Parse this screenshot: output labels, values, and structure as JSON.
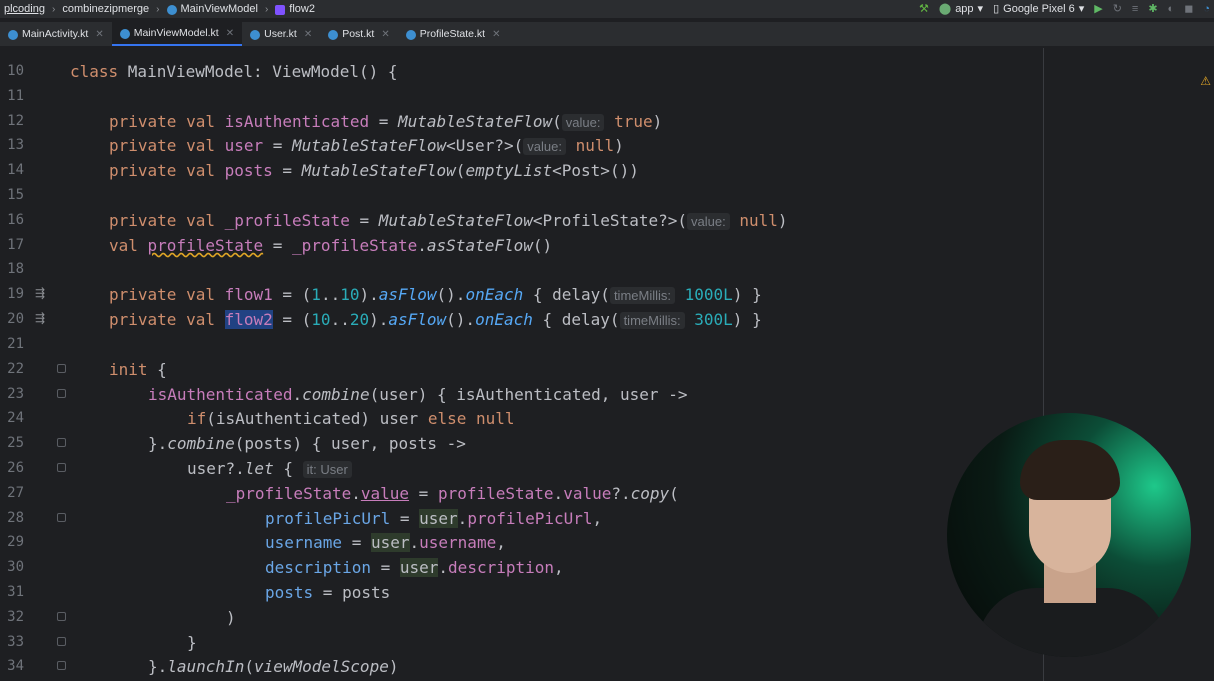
{
  "breadcrumbs": [
    "plcoding",
    "combinezipmerge",
    "MainViewModel",
    "flow2"
  ],
  "run_config": {
    "module": "app",
    "device": "Google Pixel 6"
  },
  "tabs": [
    {
      "label": "MainActivity.kt",
      "active": false
    },
    {
      "label": "MainViewModel.kt",
      "active": true
    },
    {
      "label": "User.kt",
      "active": false
    },
    {
      "label": "Post.kt",
      "active": false
    },
    {
      "label": "ProfileState.kt",
      "active": false
    }
  ],
  "line_numbers": [
    "10",
    "11",
    "12",
    "13",
    "14",
    "15",
    "16",
    "17",
    "18",
    "19",
    "20",
    "21",
    "22",
    "23",
    "24",
    "25",
    "26",
    "27",
    "28",
    "29",
    "30",
    "31",
    "32",
    "33",
    "34"
  ],
  "code": {
    "l10_kw": "class ",
    "l10_name": "MainViewModel",
    "l10_sep": ": ",
    "l10_super": "ViewModel",
    "l10_end": "() {",
    "l12_kw": "private val ",
    "l12_name": "isAuthenticated",
    "l12_eq": " = ",
    "l12_call": "MutableStateFlow",
    "l12_open": "(",
    "l12_hint": "value:",
    "l12_val": "true",
    "l12_close": ")",
    "l13_kw": "private val ",
    "l13_name": "user",
    "l13_eq": " = ",
    "l13_call": "MutableStateFlow",
    "l13_gen": "<User?>",
    "l13_open": "(",
    "l13_hint": "value:",
    "l13_val": "null",
    "l13_close": ")",
    "l14_kw": "private val ",
    "l14_name": "posts",
    "l14_eq": " = ",
    "l14_call": "MutableStateFlow",
    "l14_open": "(",
    "l14_call2": "emptyList",
    "l14_rest": "<Post>())",
    "l16_kw": "private val ",
    "l16_name": "_profileState",
    "l16_eq": " = ",
    "l16_call": "MutableStateFlow",
    "l16_gen": "<ProfileState?>",
    "l16_open": "(",
    "l16_hint": "value:",
    "l16_val": "null",
    "l16_close": ")",
    "l17_kw": "val ",
    "l17_name": "profileState",
    "l17_eq": " = ",
    "l17_ref": "_profileState",
    "l17_dot": ".",
    "l17_call": "asStateFlow",
    "l17_end": "()",
    "l19_kw": "private val ",
    "l19_name": "flow1",
    "l19_eq": " = (",
    "l19_a": "1",
    "l19_range": "..",
    "l19_b": "10",
    "l19_c": ").",
    "l19_f1": "asFlow",
    "l19_d": "().",
    "l19_f2": "onEach",
    "l19_e": " { delay(",
    "l19_hint": "timeMillis:",
    "l19_val": "1000L",
    "l19_end": ") }",
    "l20_kw": "private val ",
    "l20_name": "flow2",
    "l20_eq": " = (",
    "l20_a": "10",
    "l20_range": "..",
    "l20_b": "20",
    "l20_c": ").",
    "l20_f1": "asFlow",
    "l20_d": "().",
    "l20_f2": "onEach",
    "l20_e": " { delay(",
    "l20_hint": "timeMillis:",
    "l20_val": "300L",
    "l20_end": ") }",
    "l22_kw": "init",
    "l22_end": " {",
    "l23_ref": "isAuthenticated",
    "l23_dot": ".",
    "l23_call": "combine",
    "l23_rest": "(user) { isAuthenticated, user ->",
    "l24_kw": "if",
    "l24_mid": "(isAuthenticated) user ",
    "l24_else": "else null",
    "l25_a": "}.",
    "l25_call": "combine",
    "l25_rest": "(posts) { user, posts ->",
    "l26_a": "user?.",
    "l26_call": "let",
    "l26_b": " { ",
    "l26_hint": "it: User",
    "l27_ref": "_profileState",
    "l27_dot": ".",
    "l27_prop": "value",
    "l27_eq": " = ",
    "l27_ref2": "profileState",
    "l27_b": ".",
    "l27_prop2": "value",
    "l27_c": "?.",
    "l27_call": "copy",
    "l27_d": "(",
    "l28_prm": "profilePicUrl",
    "l28_eq": " = ",
    "l28_u": "user",
    "l28_dot": ".",
    "l28_prop": "profilePicUrl",
    "l28_end": ",",
    "l29_prm": "username",
    "l29_eq": " = ",
    "l29_u": "user",
    "l29_dot": ".",
    "l29_prop": "username",
    "l29_end": ",",
    "l30_prm": "description",
    "l30_eq": " = ",
    "l30_u": "user",
    "l30_dot": ".",
    "l30_prop": "description",
    "l30_end": ",",
    "l31_prm": "posts",
    "l31_eq": " = ",
    "l31_val": "posts",
    "l32": ")",
    "l33": "}",
    "l34_a": "}.",
    "l34_call": "launchIn",
    "l34_b": "(",
    "l34_arg": "viewModelScope",
    "l34_c": ")"
  },
  "colors": {
    "keyword": "#cf8e6d",
    "field": "#c77dbb",
    "function": "#56a8f5",
    "number": "#2aacb8",
    "selection": "#214283",
    "accent": "#3574f0"
  }
}
